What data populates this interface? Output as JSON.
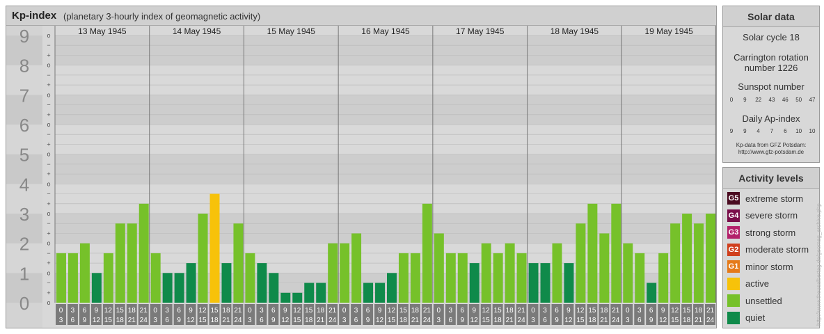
{
  "header": {
    "title": "Kp-index",
    "subtitle": "(planetary 3-hourly index of geomagnetic activity)"
  },
  "chart_data": {
    "type": "bar",
    "title": "Kp-index",
    "subtitle": "(planetary 3-hourly index of geomagnetic activity)",
    "days": [
      "13 May 1945",
      "14 May 1945",
      "15 May 1945",
      "16 May 1945",
      "17 May 1945",
      "18 May 1945",
      "19 May 1945"
    ],
    "intervals_top": [
      "0",
      "3",
      "6",
      "9",
      "12",
      "15",
      "18",
      "21"
    ],
    "intervals_bottom": [
      "3",
      "6",
      "9",
      "12",
      "15",
      "18",
      "21",
      "24"
    ],
    "yticks": [
      "0",
      "1",
      "2",
      "3",
      "4",
      "5",
      "6",
      "7",
      "8",
      "9"
    ],
    "minor_labels": [
      "+",
      "−",
      "o"
    ],
    "ylim": [
      0,
      9
    ],
    "values": [
      [
        1.667,
        1.667,
        2.0,
        1.0,
        1.667,
        2.667,
        2.667,
        3.333
      ],
      [
        1.667,
        1.0,
        1.0,
        1.333,
        3.0,
        3.667,
        1.333,
        2.667
      ],
      [
        1.667,
        1.333,
        1.0,
        0.333,
        0.333,
        0.667,
        0.667,
        2.0
      ],
      [
        2.0,
        2.333,
        0.667,
        0.667,
        1.0,
        1.667,
        1.667,
        3.333
      ],
      [
        2.333,
        1.667,
        1.667,
        1.333,
        2.0,
        1.667,
        2.0,
        1.667
      ],
      [
        1.333,
        1.333,
        2.0,
        1.333,
        2.667,
        3.333,
        2.333,
        3.333
      ],
      [
        2.0,
        1.667,
        0.667,
        1.667,
        2.667,
        3.0,
        2.667,
        3.0
      ]
    ],
    "colors": {
      "quiet": "#0f8a4a",
      "unsettled": "#76c12a",
      "active": "#f7c20a"
    }
  },
  "solar": {
    "title": "Solar data",
    "cycle": "Solar cycle 18",
    "carrington_line1": "Carrington rotation",
    "carrington_line2": "number 1226",
    "sunspot_label": "Sunspot number",
    "sunspot_values": [
      "0",
      "9",
      "22",
      "43",
      "46",
      "50",
      "47"
    ],
    "ap_label": "Daily Ap-index",
    "ap_values": [
      "9",
      "9",
      "4",
      "7",
      "6",
      "10",
      "10"
    ],
    "source_line1": "Kp-data from GFZ Potsdam:",
    "source_line2": "http://www.gfz-potsdam.de"
  },
  "activity": {
    "title": "Activity levels",
    "levels": [
      {
        "badge": "G5",
        "label": "extreme storm",
        "color": "#4a0a20"
      },
      {
        "badge": "G4",
        "label": "severe storm",
        "color": "#7a0e4a"
      },
      {
        "badge": "G3",
        "label": "strong storm",
        "color": "#b3206a"
      },
      {
        "badge": "G2",
        "label": "moderate storm",
        "color": "#d0401e"
      },
      {
        "badge": "G1",
        "label": "minor storm",
        "color": "#e57a1a"
      },
      {
        "badge": "",
        "label": "active",
        "color": "#f7c20a"
      },
      {
        "badge": "",
        "label": "unsettled",
        "color": "#76c12a"
      },
      {
        "badge": "",
        "label": "quiet",
        "color": "#0f8a4a"
      }
    ]
  },
  "watermark": "http://www.theusalbertag.de/geomag_archive.php"
}
